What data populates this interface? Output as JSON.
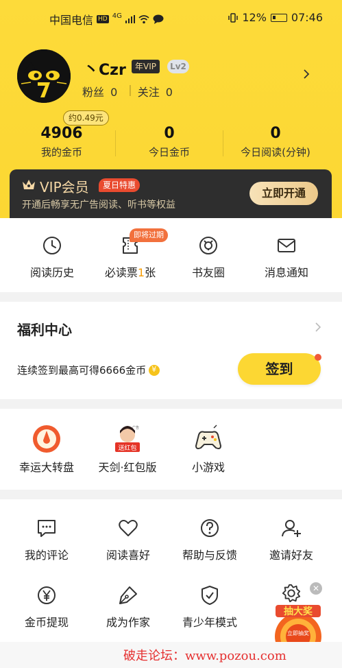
{
  "status_bar": {
    "carrier": "中国电信",
    "hd": "HD",
    "signal": "4G",
    "battery": "12%",
    "time": "07:46"
  },
  "profile": {
    "nickname": "丶Czr",
    "vip_tag": "年VIP",
    "level": "Lv2",
    "fans_label": "粉丝",
    "fans_count": "0",
    "follow_label": "关注",
    "follow_count": "0"
  },
  "stats": {
    "coin_hint": "约0.49元",
    "items": [
      {
        "value": "4906",
        "label": "我的金币"
      },
      {
        "value": "0",
        "label": "今日金币"
      },
      {
        "value": "0",
        "label": "今日阅读(分钟)"
      }
    ]
  },
  "vip_banner": {
    "title": "VIP会员",
    "promo": "夏日特惠",
    "desc": "开通后畅享无广告阅读、听书等权益",
    "button": "立即开通"
  },
  "quick_menu": {
    "expire_badge": "即将过期",
    "items": [
      {
        "label": "阅读历史",
        "icon": "clock-icon"
      },
      {
        "label_pre": "必读票",
        "label_num": "1",
        "label_post": "张",
        "icon": "ticket-icon"
      },
      {
        "label": "书友圈",
        "icon": "circle-icon"
      },
      {
        "label": "消息通知",
        "icon": "mail-icon"
      }
    ]
  },
  "welfare": {
    "title": "福利中心",
    "desc": "连续签到最高可得6666金币",
    "button": "签到"
  },
  "activities": {
    "items": [
      {
        "label": "幸运大转盘",
        "icon": "wheel-icon"
      },
      {
        "label": "天剑·红包版",
        "icon": "game-banner-icon",
        "badge": "送红包",
        "ad": "广告"
      },
      {
        "label": "小游戏",
        "icon": "gamepad-icon"
      }
    ]
  },
  "tools": {
    "row1": [
      {
        "label": "我的评论",
        "icon": "comment-icon"
      },
      {
        "label": "阅读喜好",
        "icon": "heart-icon"
      },
      {
        "label": "帮助与反馈",
        "icon": "help-icon"
      },
      {
        "label": "邀请好友",
        "icon": "add-user-icon"
      }
    ],
    "row2": [
      {
        "label": "金币提现",
        "icon": "yen-icon"
      },
      {
        "label": "成为作家",
        "icon": "pen-icon"
      },
      {
        "label": "青少年模式",
        "icon": "shield-icon"
      }
    ]
  },
  "lottery": {
    "title": "抽大奖",
    "button": "立即抽奖"
  },
  "watermark": "破走论坛：www.pozou.com",
  "colors": {
    "brand_yellow": "#fcd733",
    "vip_dark": "#2e2e2e",
    "accent_orange": "#f59b00",
    "promo_red": "#e94b2f"
  }
}
